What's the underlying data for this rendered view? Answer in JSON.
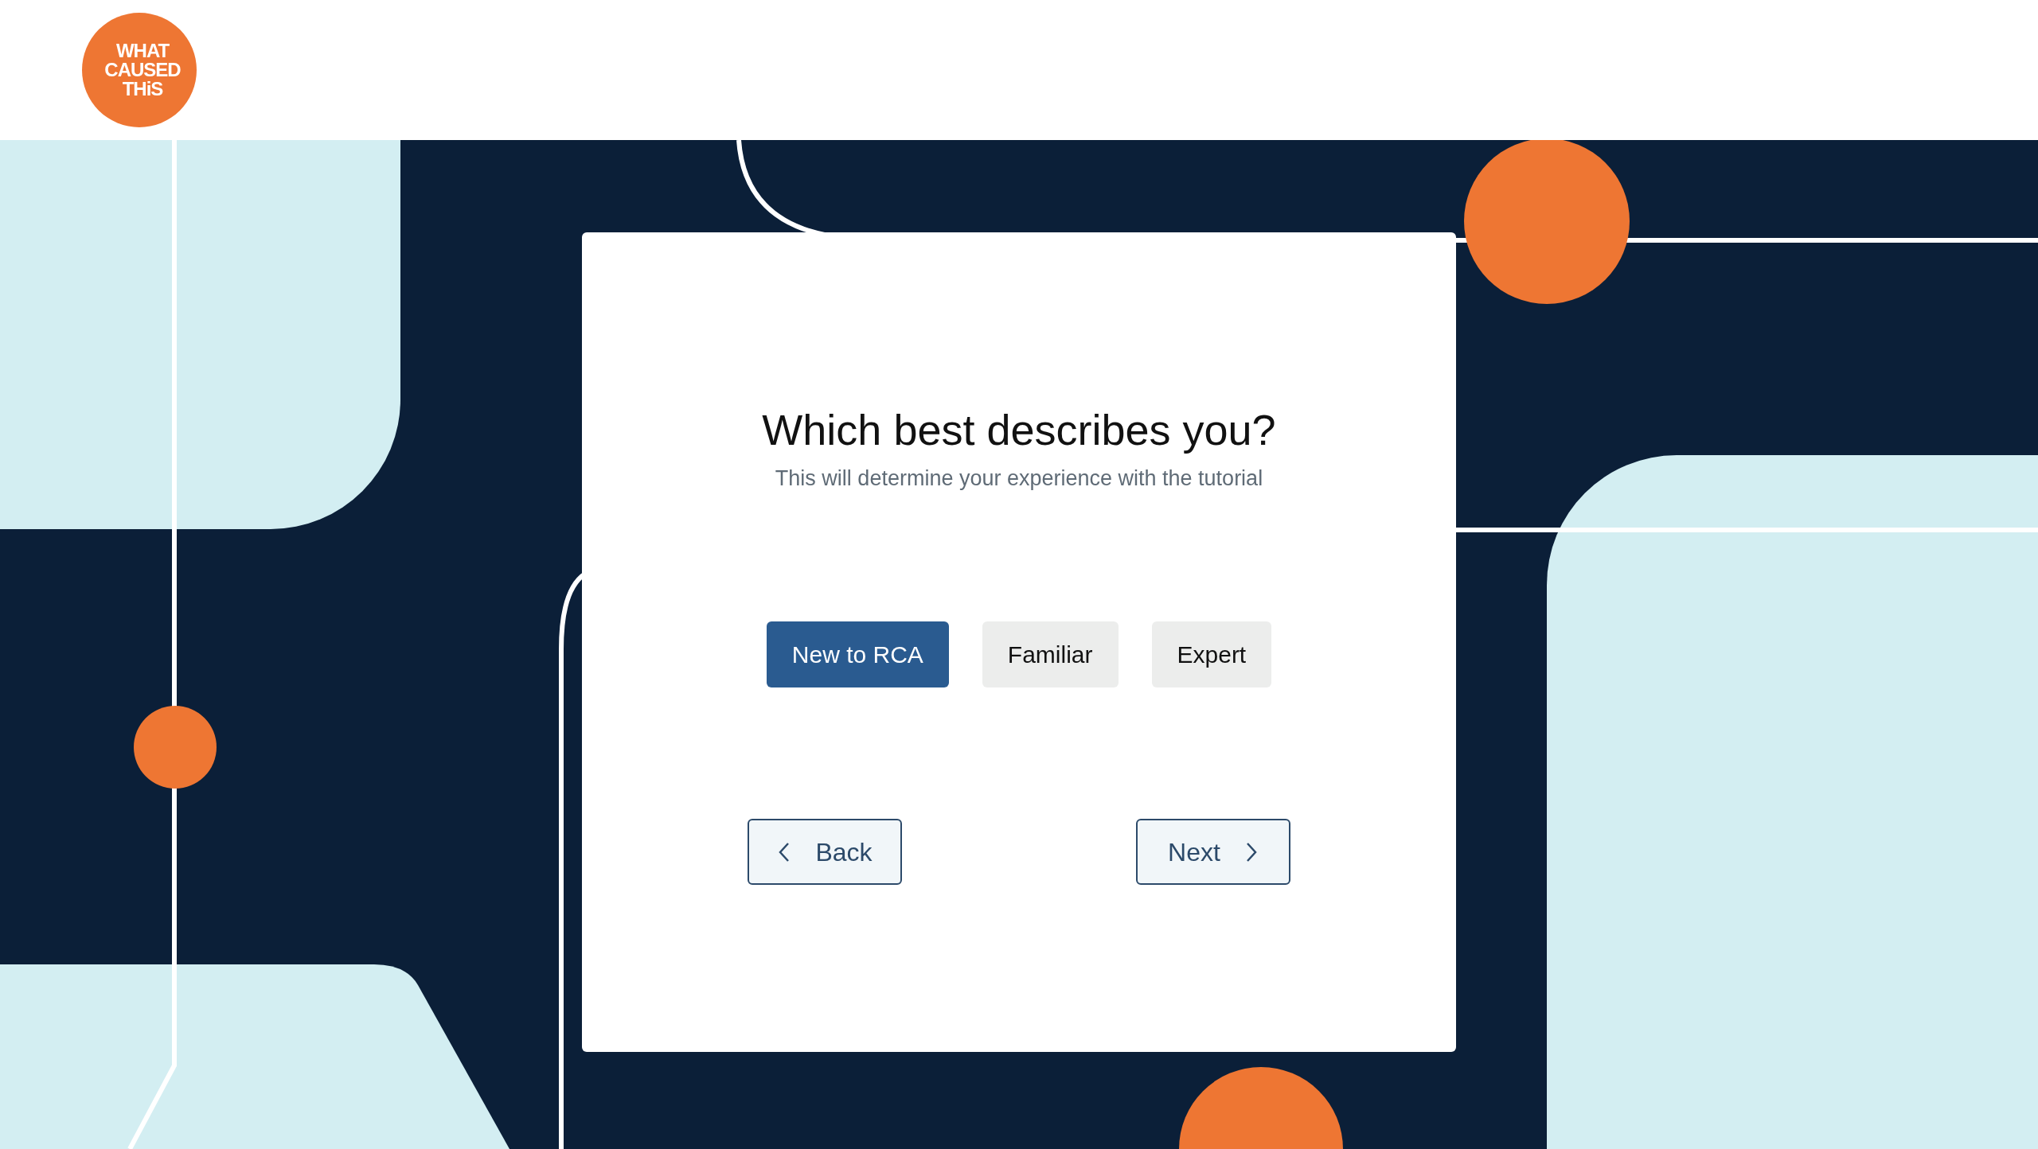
{
  "logo": {
    "lines": [
      "WHAT",
      "CAUSED",
      "THiS"
    ]
  },
  "question": {
    "title": "Which best describes you?",
    "subtitle": "This will determine your experience with the tutorial"
  },
  "options": [
    {
      "label": "New to RCA",
      "selected": true
    },
    {
      "label": "Familiar",
      "selected": false
    },
    {
      "label": "Expert",
      "selected": false
    }
  ],
  "navigation": [
    {
      "label": "Back",
      "kind": "back"
    },
    {
      "label": "Next",
      "kind": "next"
    }
  ]
}
